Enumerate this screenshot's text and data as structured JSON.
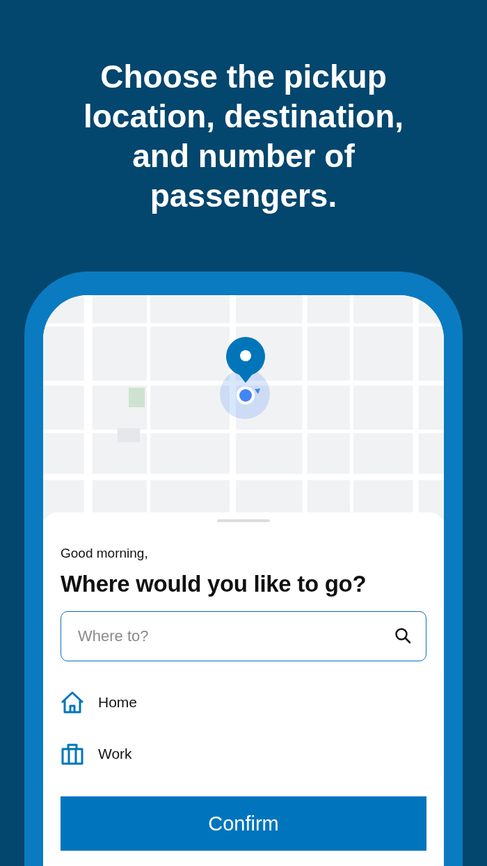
{
  "headline": "Choose the pickup location, destination, and number of passengers.",
  "sheet": {
    "greeting": "Good morning,",
    "title": "Where would you like to go?",
    "search": {
      "placeholder": "Where to?"
    },
    "places": [
      {
        "kind": "home",
        "label": "Home"
      },
      {
        "kind": "work",
        "label": "Work"
      }
    ],
    "confirm_button": "Confirm"
  }
}
